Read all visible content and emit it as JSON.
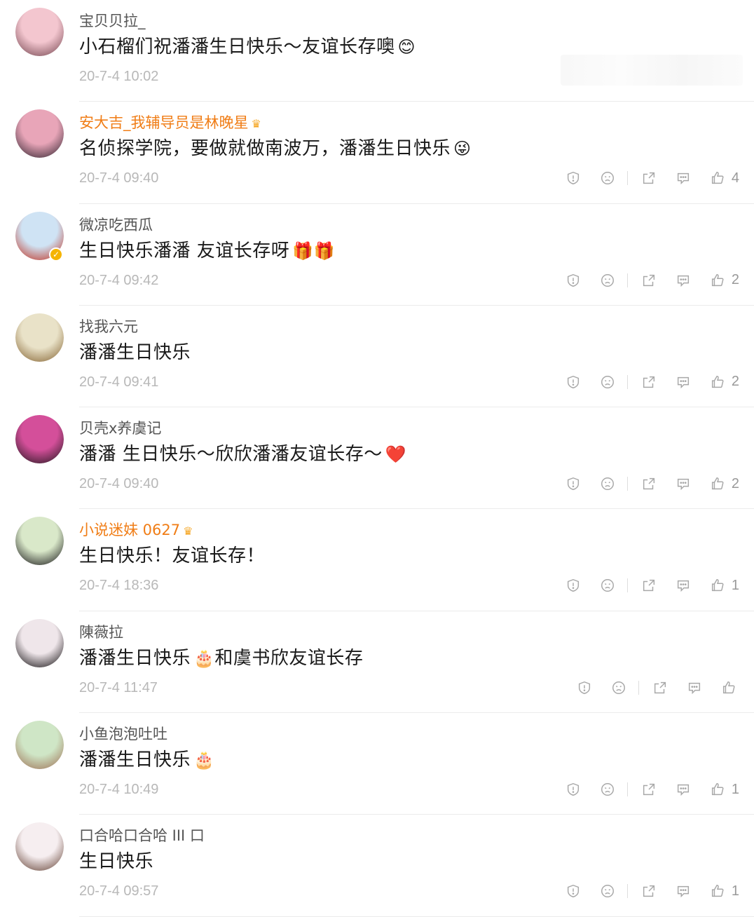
{
  "comments": [
    {
      "user": "宝贝贝拉_",
      "vip": false,
      "crown": false,
      "verified": false,
      "text": "小石榴们祝潘潘生日快乐～友谊长存噢",
      "emoji": "😊",
      "time": "20-7-4 10:02",
      "show_actions": false,
      "likes": "",
      "avatar_colors": [
        "#f3c6cf",
        "#7a4b55"
      ]
    },
    {
      "user": "安大吉_我辅导员是林晚星",
      "vip": true,
      "crown": true,
      "verified": false,
      "text": "名侦探学院，要做就做南波万，潘潘生日快乐",
      "emoji": "😜",
      "time": "20-7-4 09:40",
      "show_actions": true,
      "likes": "4",
      "avatar_colors": [
        "#e8a5b8",
        "#3a2a36"
      ]
    },
    {
      "user": "微凉吃西瓜",
      "vip": false,
      "crown": false,
      "verified": true,
      "text": "生日快乐潘潘 友谊长存呀",
      "emoji": "🎁🎁",
      "time": "20-7-4 09:42",
      "show_actions": true,
      "likes": "2",
      "avatar_colors": [
        "#cfe3f4",
        "#c0392b"
      ]
    },
    {
      "user": "找我六元",
      "vip": false,
      "crown": false,
      "verified": false,
      "text": "潘潘生日快乐",
      "emoji": "",
      "time": "20-7-4 09:41",
      "show_actions": true,
      "likes": "2",
      "avatar_colors": [
        "#e9e2c8",
        "#8a6a3a"
      ]
    },
    {
      "user": "贝壳x养虞记",
      "vip": false,
      "crown": false,
      "verified": false,
      "text": "潘潘 生日快乐～欣欣潘潘友谊长存～",
      "emoji": "❤️",
      "time": "20-7-4 09:40",
      "show_actions": true,
      "likes": "2",
      "avatar_colors": [
        "#d44f9a",
        "#2b1a24"
      ]
    },
    {
      "user": "小说迷妹 0627",
      "vip": true,
      "crown": true,
      "verified": false,
      "text": "生日快乐！友谊长存！",
      "emoji": "",
      "time": "20-7-4 18:36",
      "show_actions": true,
      "likes": "1",
      "avatar_colors": [
        "#d9e8c9",
        "#1f1f1f"
      ]
    },
    {
      "user": "陳薇拉",
      "vip": false,
      "crown": false,
      "verified": false,
      "text": "潘潘生日快乐",
      "emoji": "🎂",
      "text2": "和虞书欣友谊长存",
      "time": "20-7-4 11:47",
      "show_actions": true,
      "likes": "",
      "avatar_colors": [
        "#efe6ea",
        "#1e1a1c"
      ]
    },
    {
      "user": "小鱼泡泡吐吐",
      "vip": false,
      "crown": false,
      "verified": false,
      "text": "潘潘生日快乐",
      "emoji": "🎂",
      "time": "20-7-4 10:49",
      "show_actions": true,
      "likes": "1",
      "avatar_colors": [
        "#cfe6c6",
        "#a0765a"
      ]
    },
    {
      "user": "口合哈口合哈 III 口",
      "vip": false,
      "crown": false,
      "verified": false,
      "text": "生日快乐",
      "emoji": "",
      "time": "20-7-4 09:57",
      "show_actions": true,
      "likes": "1",
      "avatar_colors": [
        "#f6eef0",
        "#6b4a3e"
      ]
    }
  ],
  "icons": [
    "report-icon",
    "dislike-icon",
    "share-icon",
    "reply-icon",
    "like-icon"
  ],
  "colors": {
    "vip_name": "#f07d16",
    "name": "#555555",
    "text": "#1a1a1a",
    "time": "#b8b8b8",
    "icon": "#a8a8a8"
  }
}
